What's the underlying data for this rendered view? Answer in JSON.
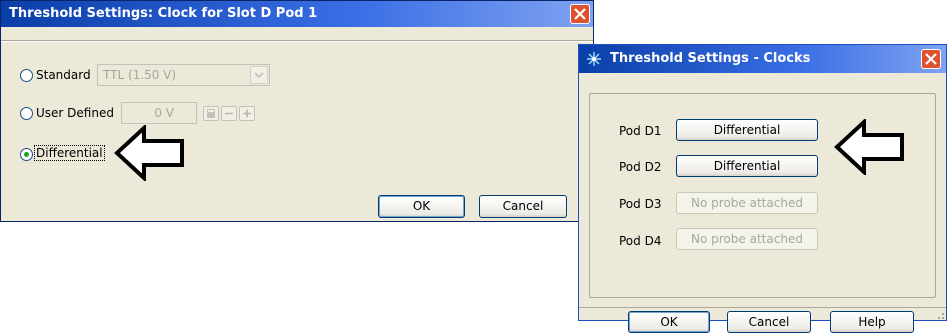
{
  "dialog1": {
    "title": "Threshold Settings: Clock for Slot D Pod 1",
    "options": {
      "standard_label": "Standard",
      "standard_value": "TTL (1.50 V)",
      "user_defined_label": "User Defined",
      "user_defined_value": "0 V",
      "differential_label": "Differential",
      "selected": "Differential"
    },
    "ok_label": "OK",
    "cancel_label": "Cancel"
  },
  "dialog2": {
    "title": "Threshold Settings - Clocks",
    "pods": [
      {
        "label": "Pod D1",
        "value": "Differential",
        "enabled": true
      },
      {
        "label": "Pod D2",
        "value": "Differential",
        "enabled": true
      },
      {
        "label": "Pod D3",
        "value": "No probe attached",
        "enabled": false
      },
      {
        "label": "Pod D4",
        "value": "No probe attached",
        "enabled": false
      }
    ],
    "ok_label": "OK",
    "cancel_label": "Cancel",
    "help_label": "Help"
  },
  "colors": {
    "title_bar": "#2b5fd9",
    "dialog_face": "#ece9d8",
    "close_button": "#e0522f",
    "selected_radio_dot": "#21a121"
  },
  "icons": [
    "close-icon",
    "dropdown-arrow-icon",
    "calculator-icon",
    "minus-icon",
    "plus-icon",
    "arrow-left-icon",
    "app-sparkle-icon"
  ]
}
